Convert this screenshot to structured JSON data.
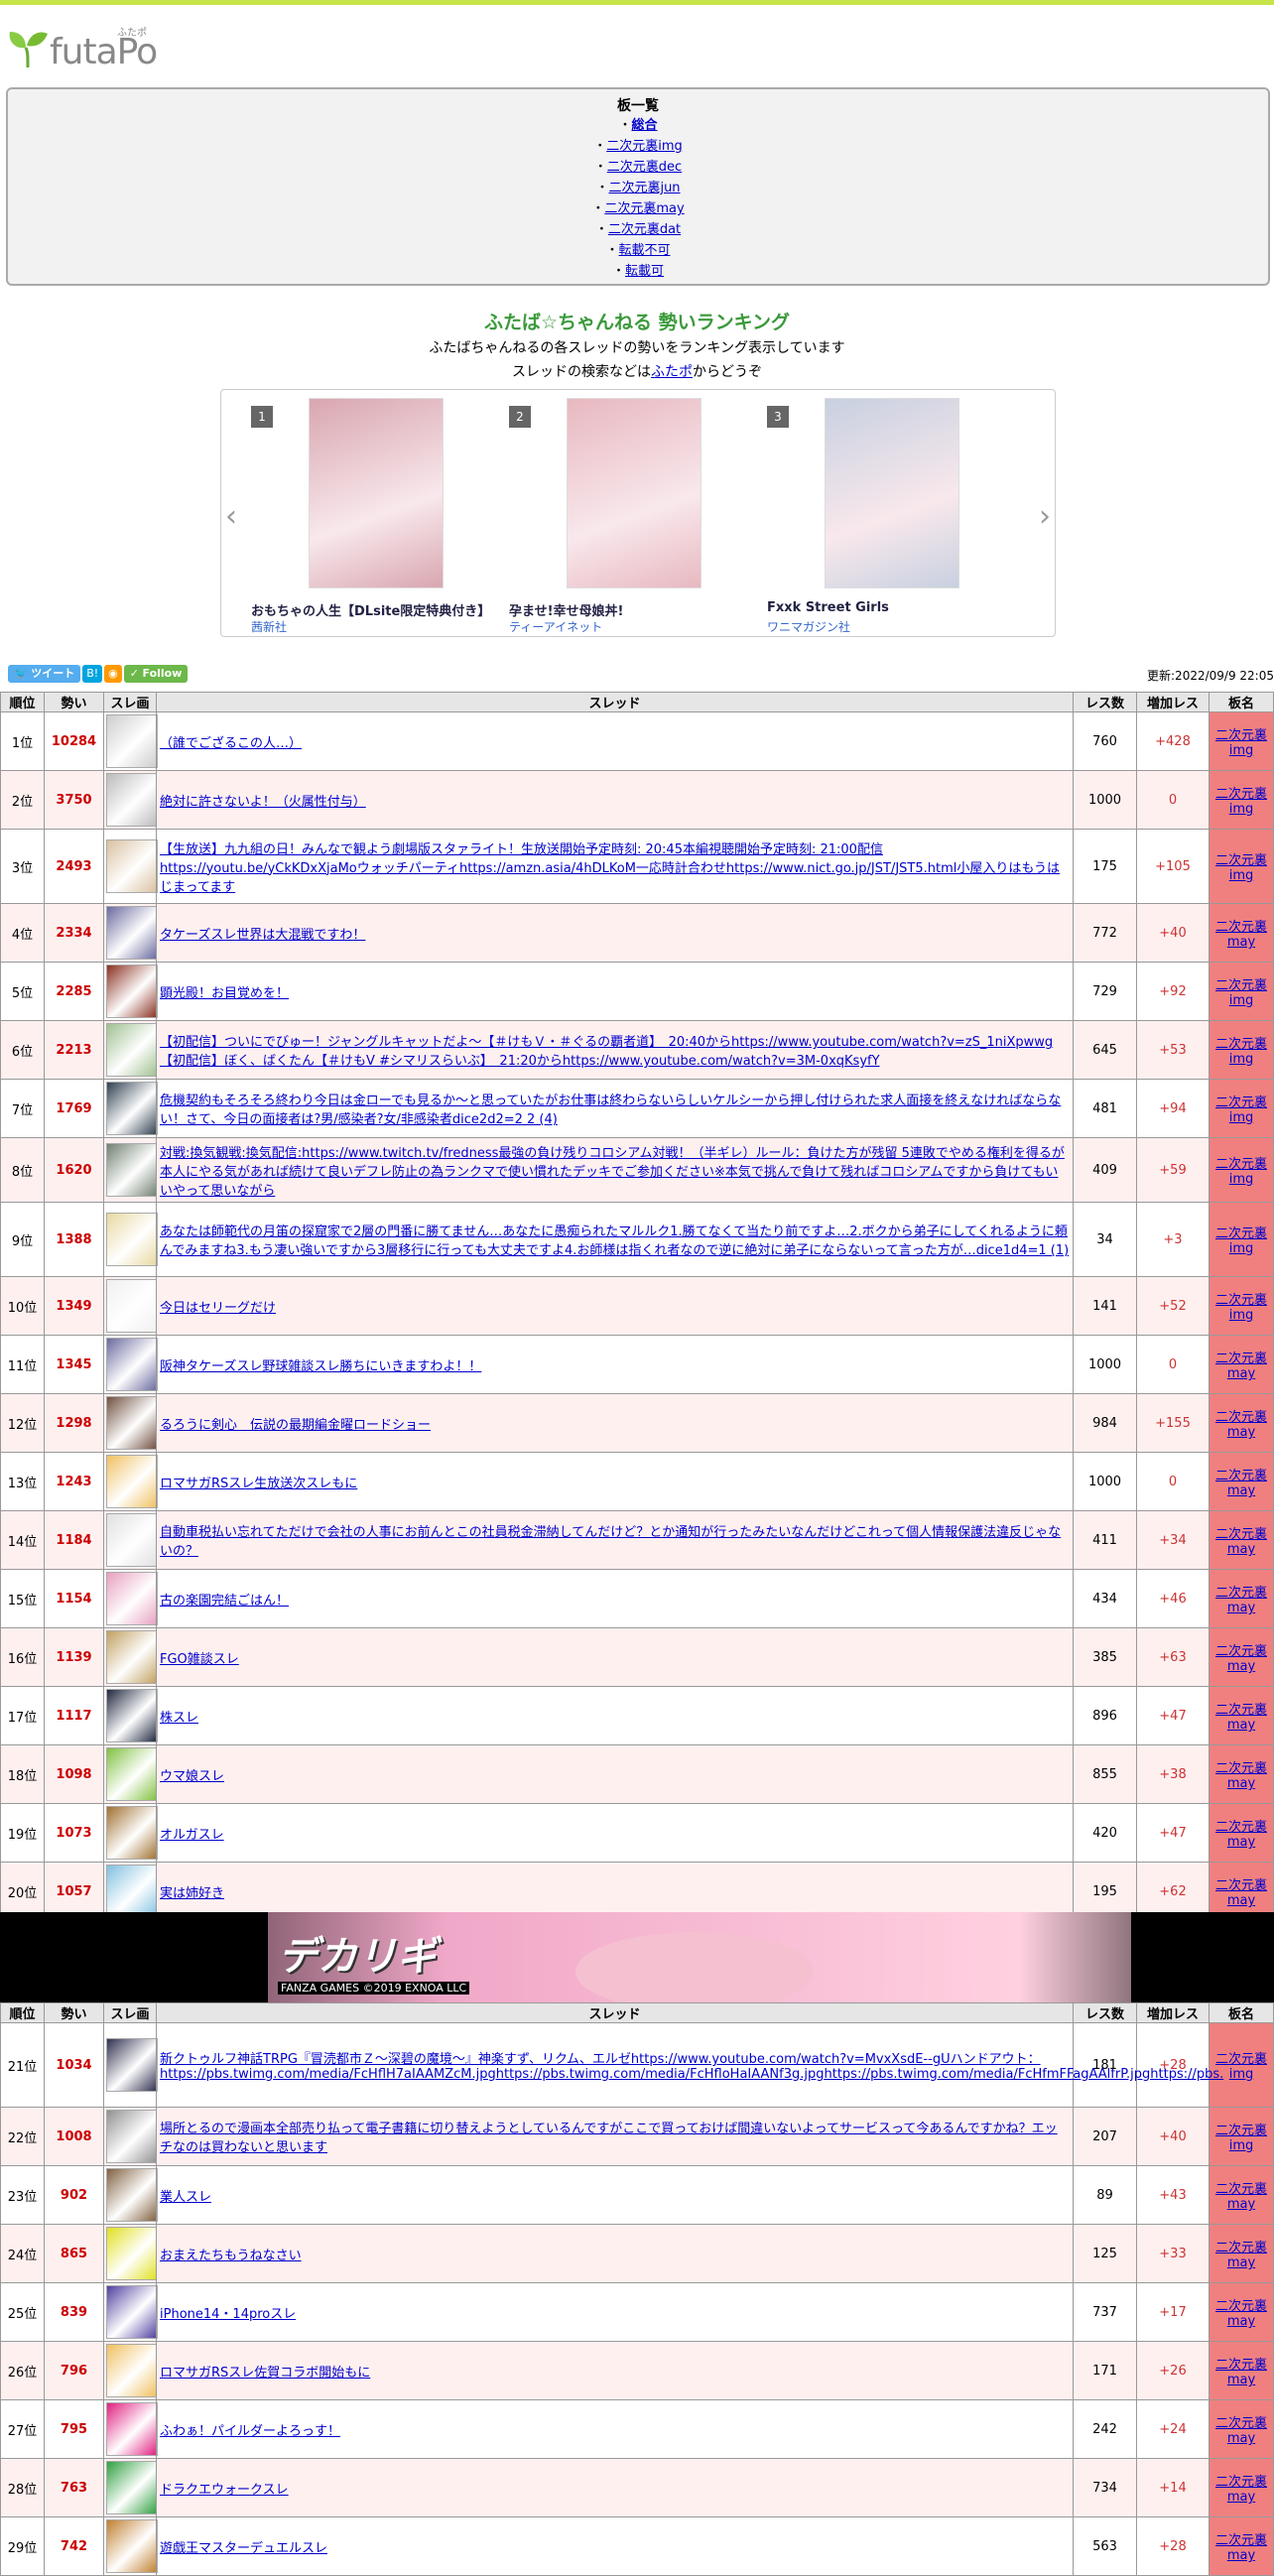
{
  "logo": {
    "text": "futaPo",
    "ruby": "ふたポ"
  },
  "boards": {
    "title": "板一覧",
    "items": [
      "総合",
      "二次元裏img",
      "二次元裏dec",
      "二次元裏jun",
      "二次元裏may",
      "二次元裏dat",
      "転載不可",
      "転載可"
    ]
  },
  "header": {
    "title": "ふたば☆ちゃんねる 勢いランキング",
    "line1": "ふたばちゃんねるの各スレッドの勢いをランキング表示しています",
    "line2_pre": "スレッドの検索などは",
    "line2_link": "ふたポ",
    "line2_post": "からどうぞ"
  },
  "carousel": {
    "items": [
      {
        "rank": "1",
        "title": "おもちゃの人生【DLsite限定特典付き】",
        "publisher": "茜新社",
        "color": "#d9a6b0"
      },
      {
        "rank": "2",
        "title": "孕ませ!幸せ母娘丼!",
        "publisher": "ティーアイネット",
        "color": "#e8b8c0"
      },
      {
        "rank": "3",
        "title": "Fxxk Street Girls",
        "publisher": "ワニマガジン社",
        "color": "#c8d0e0"
      }
    ]
  },
  "social": {
    "tweet": "ツイート",
    "hatena": "B!",
    "follow": "Follow"
  },
  "updated": "更新:2022/09/9 22:05",
  "table_headers": [
    "順位",
    "勢い",
    "スレ画",
    "スレッド",
    "レス数",
    "増加レス",
    "板名"
  ],
  "rows1": [
    {
      "rank": "1位",
      "speed": "10284",
      "title": "（誰でござるこの人…）",
      "res": "760",
      "inc": "+428",
      "board": "二次元裏img",
      "color": "#ccc"
    },
    {
      "rank": "2位",
      "speed": "3750",
      "title": "絶対に許さないよ！（火属性付与）",
      "res": "1000",
      "inc": "0",
      "board": "二次元裏img",
      "color": "#bbb"
    },
    {
      "rank": "3位",
      "speed": "2493",
      "title": "【生放送】九九組の日！みんなで観よう劇場版スタァライト！生放送開始予定時刻: 20:45本編視聴開始予定時刻: 21:00配信https://youtu.be/yCkKDxXjaMoウォッチパーティhttps://amzn.asia/4hDLKoM一応時計合わせhttps://www.nict.go.jp/JST/JST5.html小屋入りはもうはじまってます",
      "res": "175",
      "inc": "+105",
      "board": "二次元裏img",
      "color": "#d9c0a0"
    },
    {
      "rank": "4位",
      "speed": "2334",
      "title": "タケーズスレ世界は大混戦ですわ！",
      "res": "772",
      "inc": "+40",
      "board": "二次元裏may",
      "color": "#6a6aa0"
    },
    {
      "rank": "5位",
      "speed": "2285",
      "title": "顕光殿！お目覚めを！",
      "res": "729",
      "inc": "+92",
      "board": "二次元裏img",
      "color": "#8a3020"
    },
    {
      "rank": "6位",
      "speed": "2213",
      "title": "【初配信】ついにでびゅー！ジャングルキャットだよ〜【＃けもＶ・＃ぐるの覇者道】　20:40からhttps://www.youtube.com/watch?v=zS_1niXpwwg【初配信】ぼく、ばくたん【＃けもV #シマリスらいぶ】　21:20からhttps://www.youtube.com/watch?v=3M-0xqKsyfY",
      "res": "645",
      "inc": "+53",
      "board": "二次元裏img",
      "color": "#a0c090"
    },
    {
      "rank": "7位",
      "speed": "1769",
      "title": "危機契約もそろそろ終わり今日は金ローでも見るか〜と思っていたがお仕事は終わらないらしいケルシーから押し付けられた求人面接を終えなければならない！さて、今日の面接者は?男/感染者?女/非感染者dice2d2=2 2 (4)",
      "res": "481",
      "inc": "+94",
      "board": "二次元裏img",
      "color": "#304050"
    },
    {
      "rank": "8位",
      "speed": "1620",
      "title": "対戦:換気観戦:換気配信:https://www.twitch.tv/fredness最強の負け残りコロシアム対戦！（半ギレ）ルール：負けた方が残留 5連敗でやめる権利を得るが本人にやる気があれば続けて良いデフレ防止の為ランクマで使い慣れたデッキでご参加ください※本気で挑んで負けて残ればコロシアムですから負けてもいいやって思いながら",
      "res": "409",
      "inc": "+59",
      "board": "二次元裏img",
      "color": "#708070"
    },
    {
      "rank": "9位",
      "speed": "1388",
      "title": "あなたは師範代の月笛の探窟家で2層の門番に勝てません…あなたに愚痴られたマルルク1.勝てなくて当たり前ですよ…2.ボクから弟子にしてくれるように頼んでみますね3.もう凄い強いですから3層移行に行っても大丈夫ですよ4.お師様は指くれ者なので逆に絶対に弟子にならないって言った方が…dice1d4=1 (1)",
      "res": "34",
      "inc": "+3",
      "board": "二次元裏img",
      "color": "#e8d8a0"
    },
    {
      "rank": "10位",
      "speed": "1349",
      "title": "今日はセリーグだけ",
      "res": "141",
      "inc": "+52",
      "board": "二次元裏img",
      "color": "#f0f0f0"
    },
    {
      "rank": "11位",
      "speed": "1345",
      "title": "阪神タケーズスレ野球雑談スレ勝ちにいきますわよ！！",
      "res": "1000",
      "inc": "0",
      "board": "二次元裏may",
      "color": "#6a6aa0"
    },
    {
      "rank": "12位",
      "speed": "1298",
      "title": "るろうに剣心　伝説の最期編金曜ロードショー",
      "res": "984",
      "inc": "+155",
      "board": "二次元裏may",
      "color": "#705040"
    },
    {
      "rank": "13位",
      "speed": "1243",
      "title": "ロマサガRSスレ生放送次スレもに",
      "res": "1000",
      "inc": "0",
      "board": "二次元裏may",
      "color": "#f0c060"
    },
    {
      "rank": "14位",
      "speed": "1184",
      "title": "自動車税払い忘れてただけで会社の人事にお前んとこの社員税金滞納してんだけど？とか通知が行ったみたいなんだけどこれって個人情報保護法違反じゃないの？",
      "res": "411",
      "inc": "+34",
      "board": "二次元裏may",
      "color": "#e0e0e0"
    },
    {
      "rank": "15位",
      "speed": "1154",
      "title": "古の楽園完結ごはん！",
      "res": "434",
      "inc": "+46",
      "board": "二次元裏may",
      "color": "#e8a0c0"
    },
    {
      "rank": "16位",
      "speed": "1139",
      "title": "FGO雑談スレ",
      "res": "385",
      "inc": "+63",
      "board": "二次元裏may",
      "color": "#c0a060"
    },
    {
      "rank": "17位",
      "speed": "1117",
      "title": "株スレ",
      "res": "896",
      "inc": "+47",
      "board": "二次元裏may",
      "color": "#202840"
    },
    {
      "rank": "18位",
      "speed": "1098",
      "title": "ウマ娘スレ",
      "res": "855",
      "inc": "+38",
      "board": "二次元裏may",
      "color": "#80c040"
    },
    {
      "rank": "19位",
      "speed": "1073",
      "title": "オルガスレ",
      "res": "420",
      "inc": "+47",
      "board": "二次元裏may",
      "color": "#a07030"
    },
    {
      "rank": "20位",
      "speed": "1057",
      "title": "実は姉好き",
      "res": "195",
      "inc": "+62",
      "board": "二次元裏may",
      "color": "#80c0e0"
    }
  ],
  "banner": {
    "logo": "デカリギ",
    "sub": "FANZA GAMES ©2019 EXNOA LLC"
  },
  "rows2": [
    {
      "rank": "21位",
      "speed": "1034",
      "title": "新クトゥルフ神話TRPG『冒涜都市Ｚ〜深碧の魔境〜』神楽すず、リクム、エルゼhttps://www.youtube.com/watch?v=MvxXsdE--gUハンドアウト：https://pbs.twimg.com/media/FcHflH7aIAAMZcM.jpghttps://pbs.twimg.com/media/FcHfloHaIAANf3g.jpghttps://pbs.twimg.com/media/FcHfmFFagAAlfrP.jpghttps://pbs.",
      "res": "181",
      "inc": "+28",
      "board": "二次元裏img",
      "color": "#303050"
    },
    {
      "rank": "22位",
      "speed": "1008",
      "title": "場所とるので漫画本全部売り払って電子書籍に切り替えようとしているんですがここで買っておけば間違いないよってサービスって今あるんですかね？エッチなのは買わないと思います",
      "res": "207",
      "inc": "+40",
      "board": "二次元裏img",
      "color": "#909090"
    },
    {
      "rank": "23位",
      "speed": "902",
      "title": "業人スレ",
      "res": "89",
      "inc": "+43",
      "board": "二次元裏may",
      "color": "#806040"
    },
    {
      "rank": "24位",
      "speed": "865",
      "title": "おまえたちもうねなさい",
      "res": "125",
      "inc": "+33",
      "board": "二次元裏may",
      "color": "#e0e020"
    },
    {
      "rank": "25位",
      "speed": "839",
      "title": "iPhone14・14proスレ",
      "res": "737",
      "inc": "+17",
      "board": "二次元裏may",
      "color": "#5040a0"
    },
    {
      "rank": "26位",
      "speed": "796",
      "title": "ロマサガRSスレ佐賀コラボ開始もに",
      "res": "171",
      "inc": "+26",
      "board": "二次元裏may",
      "color": "#f0c060"
    },
    {
      "rank": "27位",
      "speed": "795",
      "title": "ふわぁ！パイルダーよろっす！",
      "res": "242",
      "inc": "+24",
      "board": "二次元裏may",
      "color": "#e02080"
    },
    {
      "rank": "28位",
      "speed": "763",
      "title": "ドラクエウォークスレ",
      "res": "734",
      "inc": "+14",
      "board": "二次元裏may",
      "color": "#30a040"
    },
    {
      "rank": "29位",
      "speed": "742",
      "title": "遊戯王マスターデュエルスレ",
      "res": "563",
      "inc": "+28",
      "board": "二次元裏may",
      "color": "#c08030"
    }
  ]
}
